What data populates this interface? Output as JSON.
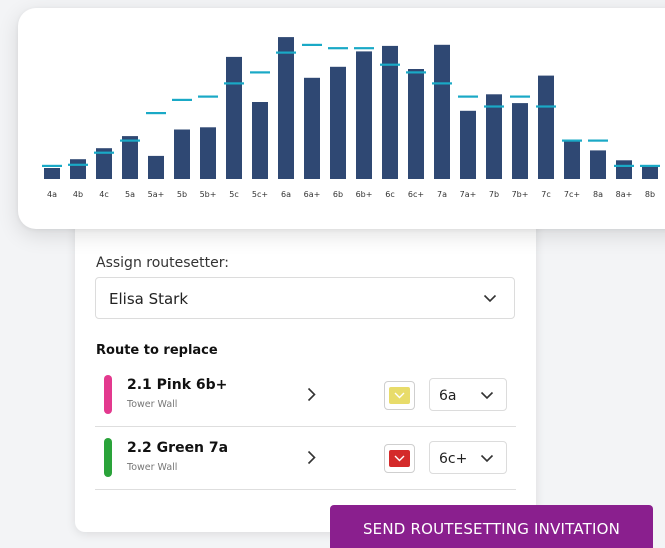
{
  "chart_data": {
    "type": "bar",
    "categories": [
      "4a",
      "4b",
      "4c",
      "5a",
      "5a+",
      "5b",
      "5b+",
      "5c",
      "5c+",
      "6a",
      "6a+",
      "6b",
      "6b+",
      "6c",
      "6c+",
      "7a",
      "7a+",
      "7b",
      "7b+",
      "7c",
      "7c+",
      "8a",
      "8a+",
      "8b"
    ],
    "series": [
      {
        "values": [
          1.0,
          1.8,
          2.8,
          3.9,
          2.1,
          4.5,
          4.7,
          11.1,
          7.0,
          12.9,
          9.2,
          10.2,
          11.6,
          12.1,
          10.0,
          12.2,
          6.2,
          7.7,
          6.9,
          9.4,
          3.5,
          2.6,
          1.7,
          1.1
        ]
      },
      {
        "values": [
          1.2,
          1.3,
          2.4,
          3.5,
          6.0,
          7.2,
          7.5,
          8.7,
          9.7,
          11.5,
          12.2,
          11.9,
          11.9,
          10.4,
          9.7,
          8.7,
          7.5,
          6.6,
          7.5,
          6.6,
          3.5,
          3.5,
          1.2,
          1.2
        ]
      }
    ],
    "colors": {
      "bars": "#2f4873",
      "markers": "#1aa9c6"
    },
    "grid": false
  },
  "form": {
    "assign_label": "Assign routesetter:",
    "routesetter": "Elisa Stark",
    "route_heading": "Route to replace",
    "routes": [
      {
        "name": "2.1 Pink 6b+",
        "wall": "Tower Wall",
        "color": "#e3398e",
        "swatch_color": "#e8dc6a",
        "grade": "6a"
      },
      {
        "name": "2.2 Green 7a",
        "wall": "Tower Wall",
        "color": "#2aa33a",
        "swatch_color": "#d42a2a",
        "grade": "6c+"
      }
    ]
  },
  "send_button": "SEND ROUTESETTING INVITATION",
  "icons": {
    "select_chevron": "chevron-down-icon",
    "row_arrow": "chevron-right-icon"
  }
}
